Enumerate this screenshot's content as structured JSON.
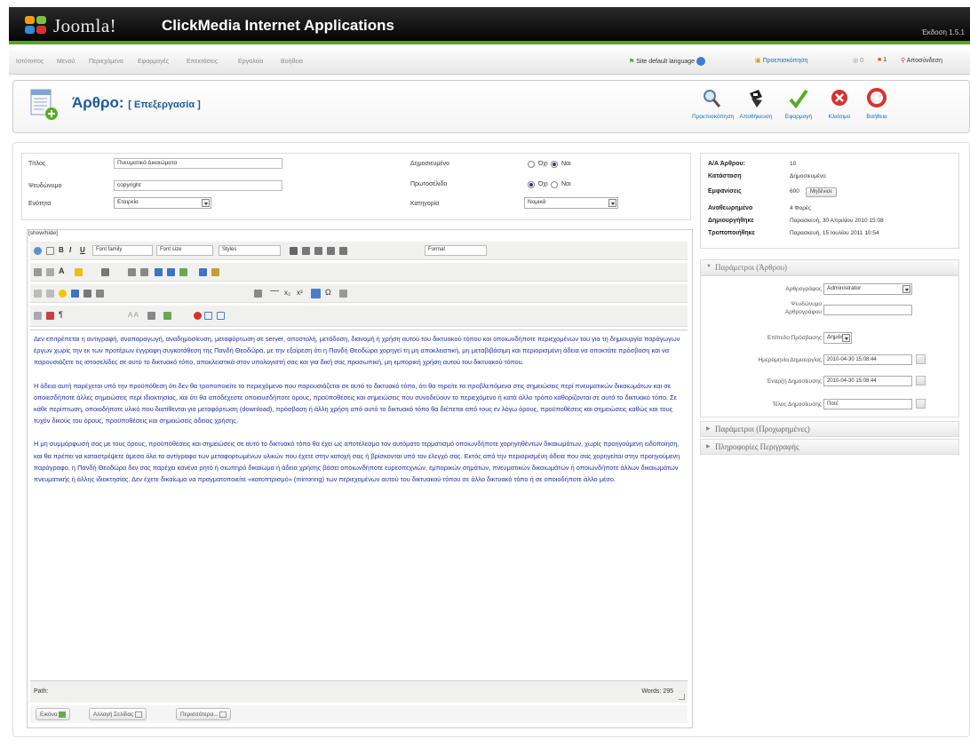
{
  "app": {
    "brand": "Joomla!",
    "site_name": "ClickMedia Internet Applications",
    "version": "Έκδοση 1.5.1"
  },
  "menu": [
    "Ιστότοπος",
    "Μενού",
    "Περιεχόμενο",
    "Εφαρμογές",
    "Επεκτάσεις",
    "Εργαλεία",
    "Βοήθεια"
  ],
  "status_bar": {
    "language": "Site default language",
    "preview": "Προεπισκόπηση",
    "messages": "0",
    "users": "1",
    "logout": "Αποσύνδεση"
  },
  "page": {
    "title": "Άρθρο:",
    "subtitle": "[ Επεξεργασία ]"
  },
  "toolbar": [
    {
      "label": "Προεπισκόπηση",
      "icon": "preview-icon"
    },
    {
      "label": "Αποθήκευση",
      "icon": "save-icon"
    },
    {
      "label": "Εφαρμογή",
      "icon": "apply-icon"
    },
    {
      "label": "Κλείσιμο",
      "icon": "close-icon"
    },
    {
      "label": "Βοήθεια",
      "icon": "help-icon"
    }
  ],
  "details": {
    "title_label": "Τίτλος",
    "title_value": "Πνευματικά Δικαιώματα",
    "alias_label": "Ψευδώνυμο",
    "alias_value": "copyright",
    "section_label": "Ενότητα",
    "section_value": "Εταιρεία",
    "published_label": "Δημοσιευμένο",
    "frontpage_label": "Πρωτοσέλιδο",
    "category_label": "Κατηγορία",
    "category_value": "Νομικά",
    "opt_no": "Όχι",
    "opt_yes": "Ναι"
  },
  "info": {
    "id_label": "Α/Α Άρθρου:",
    "id_value": "10",
    "state_label": "Κατάσταση",
    "state_value": "Δημοσιευμένο",
    "hits_label": "Εμφανίσεις",
    "hits_value": "600",
    "reset_label": "Μηδένισε",
    "revised_label": "Αναθεωρημένο",
    "revised_value": "4 Φορές",
    "created_label": "Δημιουργήθηκε",
    "created_value": "Παρασκευή, 30 Απριλίου 2010 15:08",
    "modified_label": "Τροποποιήθηκε",
    "modified_value": "Παρασκευή, 15 Ιουλίου 2011 10:54"
  },
  "params": {
    "head": "Παράμετροι (Άρθρου)",
    "author_label": "Αρθρογράφος",
    "author_value": "Administrator",
    "alias_label1": "Ψευδώνυμο",
    "alias_label2": "Αρθρογράφου",
    "access_label": "Επίπεδο Πρόσβασης",
    "access_value": "Δημόσιο",
    "created_label": "Ημερομηνία Δημιουργίας",
    "created_value": "2010-04-30 15:08:44",
    "start_label": "Έναρξη Δημοσίευσης",
    "start_value": "2010-04-30 15:08:44",
    "end_label": "Τέλος Δημοσίευσης",
    "end_value": "Ποτέ",
    "advanced_head": "Παράμετροι (Προχωρημένες)",
    "meta_head": "Πληροφορίες Περιγραφής"
  },
  "editor": {
    "showhide": "[show/hide]",
    "font_family": "Font family",
    "font_size": "Font size",
    "styles": "Styles",
    "format": "Format",
    "paragraphs": [
      "Δεν επιτρέπεται η αντιγραφή, αναπαραγωγή, αναδημοσίευση, μεταφόρτωση σε server, αποστολή, μετάδοση, διανομή ή χρήση αυτού του δικτυακού τόπου και οποιωνδήποτε περιεχομένων του για τη δημιουργία παράγωγων έργων χωρίς την εκ των προτέρων έγγραφη συγκατάθεση της Πανδή Θεοδώρα, με την εξαίρεση ότι η Πανδή Θεοδώρα χορηγεί τη μη αποκλειστική, μη μεταβιβάσιμη και περιορισμένη άδεια να αποκτάτε πρόσβαση και να παρουσιάζετε τις ιστοσελίδες σε αυτό το δικτυακό τόπο, αποκλειστικά στον υπολογιστή σας και για δική σας προσωπική, μη εμπορική χρήση αυτού του δικτυακού τόπου.",
      "Η άδεια αυτή παρέχεται υπό την προϋπόθεση ότι δεν θα τροποποιείτε το περιεχόμενο που παρουσιάζεται σε αυτό το δικτυακό τόπο, ότι θα τηρείτε τα προβλεπόμενα στις σημειώσεις περί πνευματικών δικαιωμάτων και σε οποιεσδήποτε άλλες σημειώσεις περί ιδιοκτησίας, και ότι θα αποδέχεστε οποιουσδήποτε όρους, προϋποθέσεις και σημειώσεις που συνοδεύουν το περιεχόμενο ή κατά άλλο τρόπο καθορίζονται σε αυτό το δικτυακό τόπο. Σε κάθε περίπτωση, οποιοδήποτε υλικό που διατίθενται για μεταφόρτωση (download), πρόσβαση ή άλλη χρήση από αυτό το δικτυακό τόπο θα διέπεται από τους εν λόγω όρους, προϋποθέσεις και σημειώσεις καθώς και τους τυχόν δικούς του όρους, προϋποθέσεις και σημειώσεις άδειας χρήσης.",
      "Η μη συμμόρφωσή σας με τους όρους, προϋποθέσεις και σημειώσεις σε αυτό το δικτυακό τόπο θα έχει ως αποτέλεσμα τον αυτόματο τερματισμό οποιωνδήποτε χορηγηθέντων δικαιωμάτων, χωρίς προηγούμενη ειδοποίηση, και θα πρέπει να καταστρέψετε άμεσα όλα τα αντίγραφα των μεταφορτωμένων υλικών που έχετε στην κατοχή σας ή βρίσκονται υπό τον έλεγχό σας. Εκτός από την περιορισμένη άδεια που σας χορηγείται στην προηγούμενη παράγραφο, η Πανδή Θεοδώρα δεν σας παρέχει κανένα ρητό ή σιωπηρό δικαίωμα ή άδεια χρήσης βάσει οποιωνδήποτε ευρεσιτεχνιών, εμπορικών σημάτων, πνευματικών δικαιωμάτων ή οποιωνδήποτε άλλων δικαιωμάτων πνευματικής ή άλλης ιδιοκτησίας. Δεν έχετε δικαίωμα να πραγματοποιείτε «κατοπτρισμό» (mirroring) των περιεχομένων αυτού του δικτυακού τόπου σε άλλο δικτυακό τόπο ή σε οποιοδήποτε άλλο μέσο."
    ],
    "path_label": "Path:",
    "words": "Words: 295",
    "btn_image": "Εικόνα",
    "btn_pagebreak": "Αλλαγή Σελίδας",
    "btn_readmore": "Περισσότερα..."
  },
  "colors": {
    "accent": "#5a9f2a",
    "title": "#1a5a9a",
    "editor_text": "#1f2fa0"
  }
}
